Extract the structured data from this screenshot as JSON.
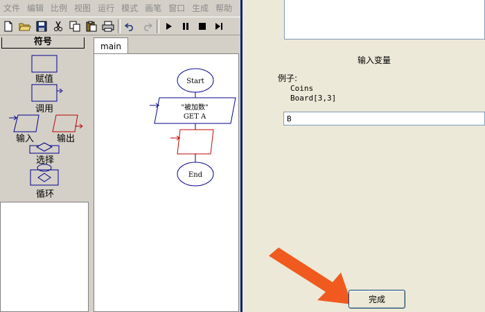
{
  "menu": [
    "文件",
    "编辑",
    "比例",
    "视图",
    "运行",
    "模式",
    "画笔",
    "窗口",
    "生成",
    "帮助"
  ],
  "toolbar": {
    "icons": [
      "new-file-icon",
      "open-folder-icon",
      "save-icon",
      "cut-icon",
      "copy-icon",
      "paste-icon",
      "print-icon",
      "undo-icon",
      "redo-icon",
      "run-icon",
      "pause-icon",
      "stop-icon",
      "step-icon"
    ]
  },
  "symbols": {
    "title": "符号",
    "items": [
      "赋值",
      "调用",
      "输入",
      "输出",
      "选择",
      "循环"
    ]
  },
  "editor": {
    "tab": "main",
    "flowchart": {
      "start": "Start",
      "input_line1": "\"被加数\"",
      "input_line2": "GET A",
      "end": "End"
    }
  },
  "dialog": {
    "title": "输入变量",
    "example_label": "例子:",
    "examples": [
      "Coins",
      "Board[3,3]"
    ],
    "input_value": "B",
    "done_button": "完成"
  },
  "colors": {
    "symbol_blue": "#00008B",
    "symbol_red": "#C00000",
    "arrow_orange": "#F05A1E"
  }
}
